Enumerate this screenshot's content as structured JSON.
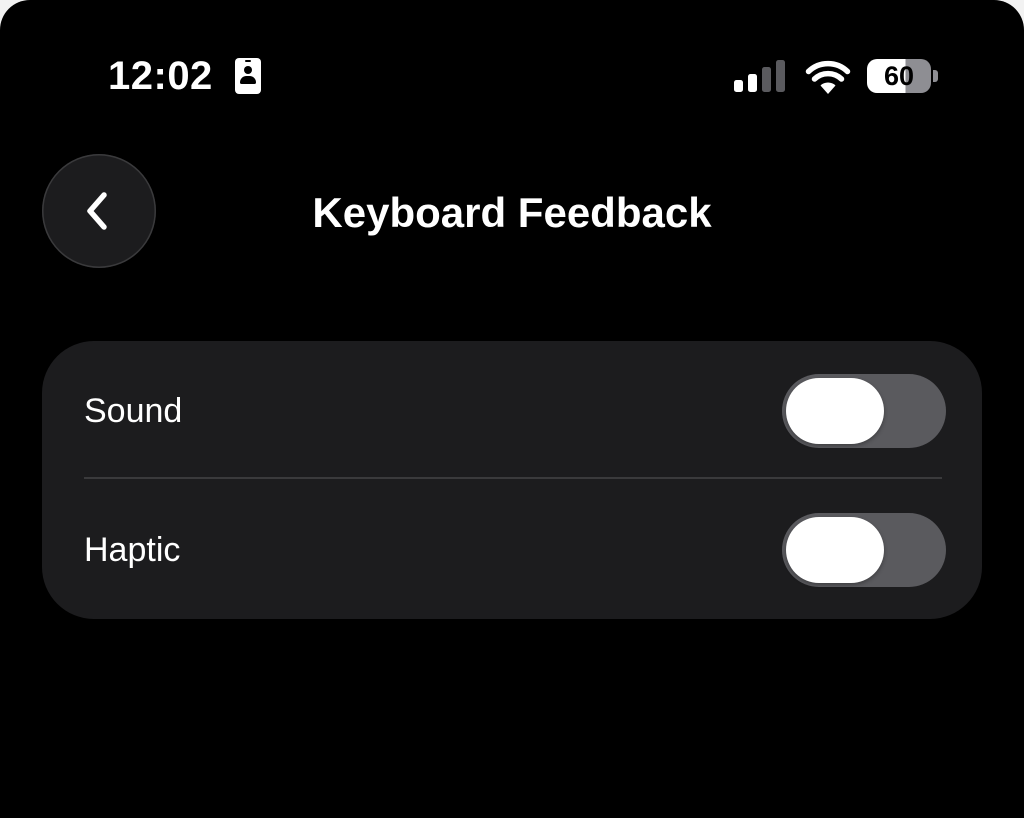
{
  "status_bar": {
    "time": "12:02",
    "battery_level": "60",
    "icons": [
      "contact-card-icon",
      "cellular-signal-icon",
      "wifi-icon",
      "battery-icon"
    ]
  },
  "nav": {
    "back_icon": "chevron-left-icon",
    "title": "Keyboard Feedback"
  },
  "settings": {
    "items": [
      {
        "label": "Sound",
        "enabled": false
      },
      {
        "label": "Haptic",
        "enabled": false
      }
    ]
  },
  "colors": {
    "background": "#000000",
    "group_background": "#1c1c1e",
    "toggle_off": "#5a5a5e",
    "text": "#ffffff"
  }
}
